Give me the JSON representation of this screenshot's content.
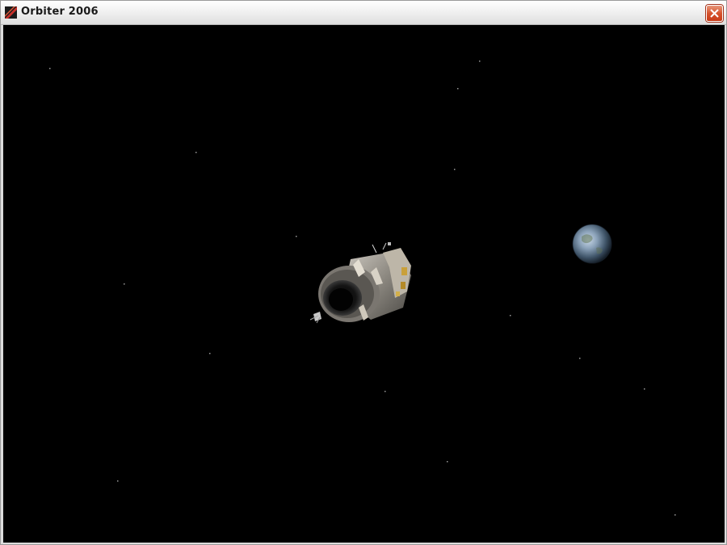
{
  "window": {
    "title": "Orbiter 2006"
  },
  "titlebar": {
    "close_icon": "close-icon",
    "app_icon": "orbiter-logo-icon"
  },
  "scene": {
    "background_color": "#000000",
    "objects": [
      "spacecraft",
      "planet-earth",
      "starfield"
    ]
  }
}
